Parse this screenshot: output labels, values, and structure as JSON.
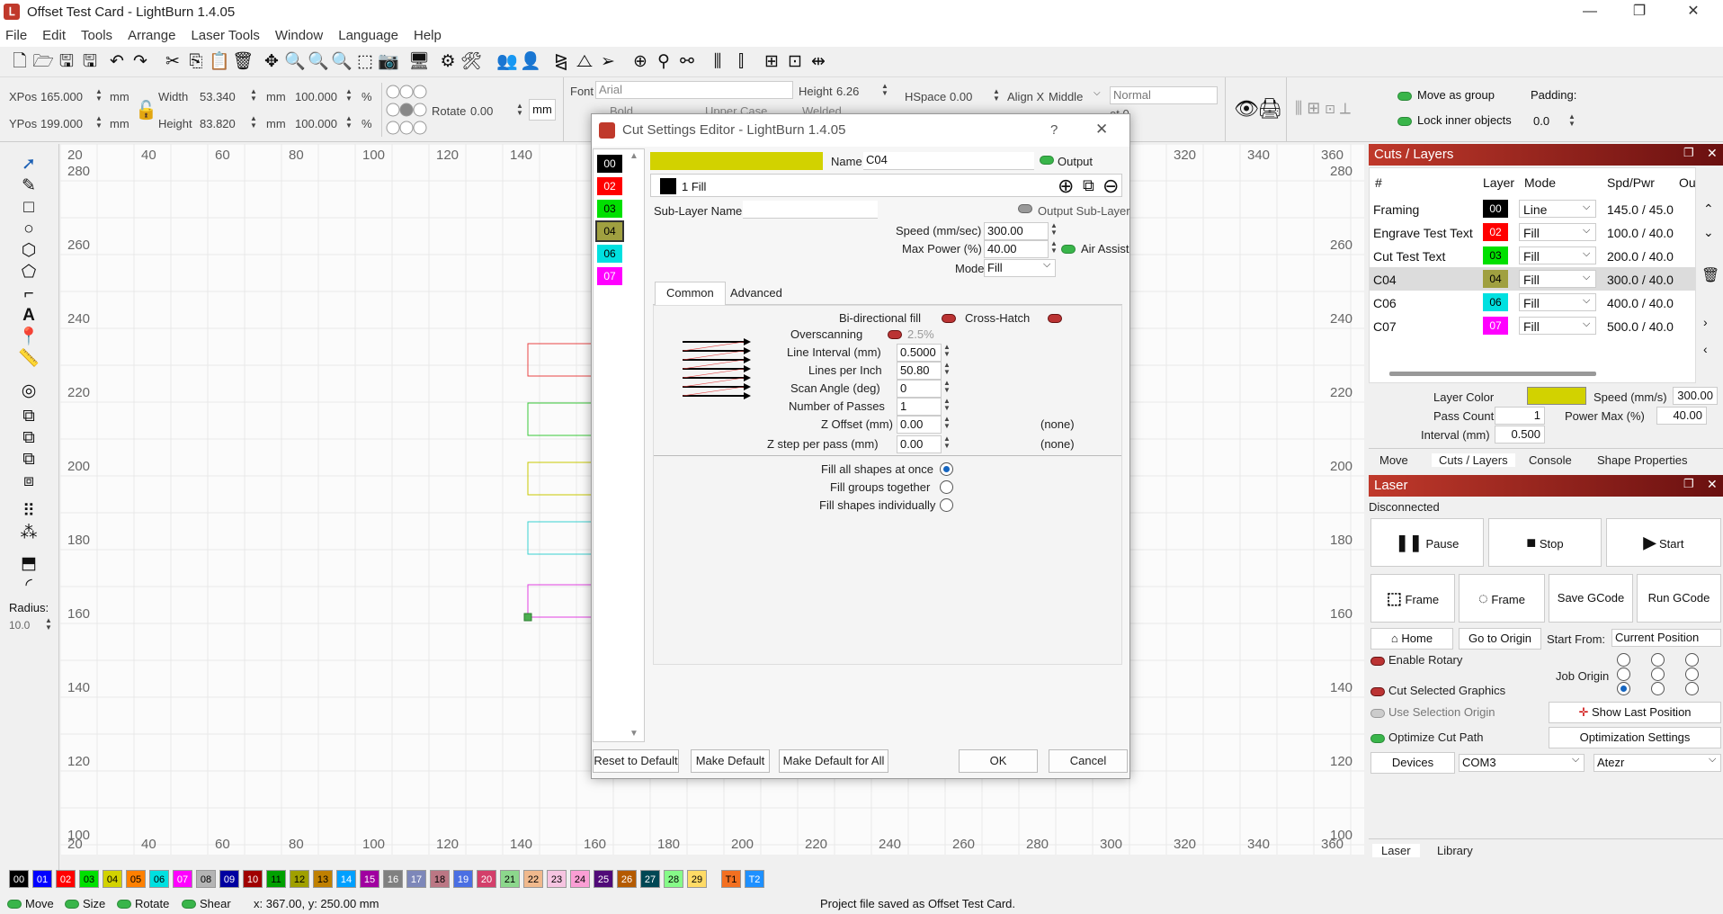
{
  "title": "Offset Test Card - LightBurn 1.4.05",
  "menu": [
    "File",
    "Edit",
    "Tools",
    "Arrange",
    "Laser Tools",
    "Window",
    "Language",
    "Help"
  ],
  "props": {
    "xpos_label": "XPos",
    "xpos": "165.000",
    "ypos_label": "YPos",
    "ypos": "199.000",
    "mm": "mm",
    "width_label": "Width",
    "width": "53.340",
    "height_label": "Height",
    "height": "83.820",
    "pct": "100.000",
    "pct_sign": "%",
    "rotate_label": "Rotate",
    "rotate": "0.00",
    "unit_btn": "mm",
    "font_label": "Font",
    "font": "Arial",
    "fheight_label": "Height",
    "fheight": "6.26",
    "hspace_label": "HSpace",
    "hspace": "0.00",
    "alignx": "Align X",
    "alignx_val": "Middle",
    "normal": "Normal",
    "bold": "Bold",
    "upper": "Upper Case",
    "welded": "Welded",
    "offset_val": "et 0",
    "move_group": "Move as group",
    "lock_inner": "Lock inner objects",
    "padding_label": "Padding:",
    "padding": "0.0"
  },
  "left": {
    "radius_label": "Radius:",
    "radius": "10.0"
  },
  "ruler": {
    "x": [
      "20",
      "40",
      "60",
      "80",
      "100",
      "120",
      "140",
      "160",
      "180",
      "200",
      "220",
      "240",
      "260",
      "280",
      "300",
      "320",
      "340",
      "360"
    ],
    "y": [
      "280",
      "260",
      "240",
      "220",
      "200",
      "180",
      "160",
      "140",
      "120",
      "100"
    ],
    "top_partial": [
      "20",
      "40",
      "60",
      "80",
      "100",
      "120",
      "140",
      "1",
      "320",
      "340",
      "360"
    ]
  },
  "palette": [
    {
      "n": "00",
      "c": "#000000",
      "t": "#fff"
    },
    {
      "n": "01",
      "c": "#0000ff",
      "t": "#fff"
    },
    {
      "n": "02",
      "c": "#ff0000",
      "t": "#fff"
    },
    {
      "n": "03",
      "c": "#00e000",
      "t": "#000"
    },
    {
      "n": "04",
      "c": "#d2d200",
      "t": "#000"
    },
    {
      "n": "05",
      "c": "#ff8000",
      "t": "#000"
    },
    {
      "n": "06",
      "c": "#00e0e0",
      "t": "#000"
    },
    {
      "n": "07",
      "c": "#ff00ff",
      "t": "#fff"
    },
    {
      "n": "08",
      "c": "#b4b4b4",
      "t": "#000"
    },
    {
      "n": "09",
      "c": "#0000a0",
      "t": "#fff"
    },
    {
      "n": "10",
      "c": "#a00000",
      "t": "#fff"
    },
    {
      "n": "11",
      "c": "#00a000",
      "t": "#000"
    },
    {
      "n": "12",
      "c": "#a0a000",
      "t": "#000"
    },
    {
      "n": "13",
      "c": "#c08000",
      "t": "#000"
    },
    {
      "n": "14",
      "c": "#00a0ff",
      "t": "#fff"
    },
    {
      "n": "15",
      "c": "#a000a0",
      "t": "#fff"
    },
    {
      "n": "16",
      "c": "#808080",
      "t": "#fff"
    },
    {
      "n": "17",
      "c": "#7d87b9",
      "t": "#fff"
    },
    {
      "n": "18",
      "c": "#bb7784",
      "t": "#000"
    },
    {
      "n": "19",
      "c": "#4a6fe3",
      "t": "#fff"
    },
    {
      "n": "20",
      "c": "#d33f6a",
      "t": "#fff"
    },
    {
      "n": "21",
      "c": "#8cd78c",
      "t": "#000"
    },
    {
      "n": "22",
      "c": "#f0b98d",
      "t": "#000"
    },
    {
      "n": "23",
      "c": "#f6c4e1",
      "t": "#000"
    },
    {
      "n": "24",
      "c": "#fa9ed4",
      "t": "#000"
    },
    {
      "n": "25",
      "c": "#500a78",
      "t": "#fff"
    },
    {
      "n": "26",
      "c": "#b45a00",
      "t": "#fff"
    },
    {
      "n": "27",
      "c": "#004754",
      "t": "#fff"
    },
    {
      "n": "28",
      "c": "#86fa88",
      "t": "#000"
    },
    {
      "n": "29",
      "c": "#ffdb66",
      "t": "#000"
    },
    {
      "n": "T1",
      "c": "#f37021",
      "t": "#000"
    },
    {
      "n": "T2",
      "c": "#1e90ff",
      "t": "#fff"
    }
  ],
  "status": {
    "move": "Move",
    "size": "Size",
    "rotate": "Rotate",
    "shear": "Shear",
    "coords": "x: 367.00, y: 250.00 mm",
    "message": "Project file saved as Offset Test Card."
  },
  "dialog": {
    "title": "Cut Settings Editor - LightBurn 1.4.05",
    "help": "?",
    "layers": [
      {
        "n": "00",
        "c": "#000000",
        "t": "#fff"
      },
      {
        "n": "02",
        "c": "#ff0000",
        "t": "#fff"
      },
      {
        "n": "03",
        "c": "#00e000",
        "t": "#000"
      },
      {
        "n": "04",
        "c": "#a0a040",
        "t": "#000"
      },
      {
        "n": "06",
        "c": "#00e0e0",
        "t": "#000"
      },
      {
        "n": "07",
        "c": "#ff00ff",
        "t": "#fff"
      }
    ],
    "name_label": "Name",
    "name": "C04",
    "output": "Output",
    "sublayer": "1 Fill",
    "sublayer_name_label": "Sub-Layer Name",
    "output_sub": "Output Sub-Layer",
    "speed_label": "Speed (mm/sec)",
    "speed": "300.00",
    "maxpower_label": "Max Power (%)",
    "maxpower": "40.00",
    "air_assist": "Air Assist",
    "mode_label": "Mode",
    "mode": "Fill",
    "tab_common": "Common",
    "tab_advanced": "Advanced",
    "bidir": "Bi-directional fill",
    "crosshatch": "Cross-Hatch",
    "overscan_label": "Overscanning",
    "overscan": "2.5%",
    "line_interval_label": "Line Interval (mm)",
    "line_interval": "0.5000",
    "lpi_label": "Lines per Inch",
    "lpi": "50.80",
    "scan_angle_label": "Scan Angle (deg)",
    "scan_angle": "0",
    "passes_label": "Number of Passes",
    "passes": "1",
    "zoffset_label": "Z Offset (mm)",
    "zoffset": "0.00",
    "zstep_label": "Z step per pass (mm)",
    "zstep": "0.00",
    "none": "(none)",
    "fill_all": "Fill all shapes at once",
    "fill_groups": "Fill groups together",
    "fill_indiv": "Fill shapes individually",
    "reset": "Reset to Default",
    "make_default": "Make Default",
    "make_default_all": "Make Default for All",
    "ok": "OK",
    "cancel": "Cancel",
    "layer_color": "#d2d200"
  },
  "cuts": {
    "title": "Cuts / Layers",
    "headers": [
      "#",
      "Layer",
      "Mode",
      "Spd/Pwr",
      "Ou"
    ],
    "rows": [
      {
        "name": "Framing",
        "n": "00",
        "c": "#000000",
        "t": "#fff",
        "mode": "Line",
        "sp": "145.0 / 45.0"
      },
      {
        "name": "Engrave Test Text",
        "n": "02",
        "c": "#ff0000",
        "t": "#fff",
        "mode": "Fill",
        "sp": "100.0 / 40.0"
      },
      {
        "name": "Cut Test Text",
        "n": "03",
        "c": "#00e000",
        "t": "#000",
        "mode": "Fill",
        "sp": "200.0 / 40.0"
      },
      {
        "name": "C04",
        "n": "04",
        "c": "#a0a040",
        "t": "#000",
        "mode": "Fill",
        "sp": "300.0 / 40.0"
      },
      {
        "name": "C06",
        "n": "06",
        "c": "#00e0e0",
        "t": "#000",
        "mode": "Fill",
        "sp": "400.0 / 40.0"
      },
      {
        "name": "C07",
        "n": "07",
        "c": "#ff00ff",
        "t": "#fff",
        "mode": "Fill",
        "sp": "500.0 / 40.0"
      }
    ],
    "layer_color_label": "Layer Color",
    "speed_label": "Speed (mm/s)",
    "speed": "300.00",
    "passcount_label": "Pass Count",
    "passcount": "1",
    "powermax_label": "Power Max (%)",
    "powermax": "40.00",
    "interval_label": "Interval (mm)",
    "interval": "0.500",
    "tabs": [
      "Move",
      "Cuts / Layers",
      "Console",
      "Shape Properties"
    ]
  },
  "laser": {
    "title": "Laser",
    "status": "Disconnected",
    "pause": "Pause",
    "stop": "Stop",
    "start": "Start",
    "frame1": "Frame",
    "frame2": "Frame",
    "save_gcode": "Save GCode",
    "run_gcode": "Run GCode",
    "home": "Home",
    "go_origin": "Go to Origin",
    "start_from_label": "Start From:",
    "start_from": "Current Position",
    "enable_rotary": "Enable Rotary",
    "job_origin": "Job Origin",
    "cut_selected": "Cut Selected Graphics",
    "use_sel_origin": "Use Selection Origin",
    "show_last": "Show Last Position",
    "optimize": "Optimize Cut Path",
    "opt_settings": "Optimization Settings",
    "devices": "Devices",
    "port": "COM3",
    "device": "Atezr",
    "tabs": [
      "Laser",
      "Library"
    ]
  }
}
